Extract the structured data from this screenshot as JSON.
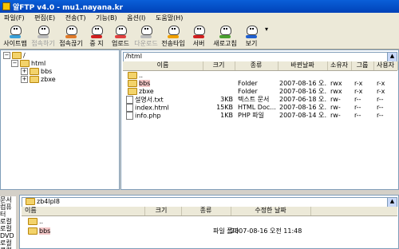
{
  "window": {
    "title": "알FTP v4.0 - mu1.nayana.kr"
  },
  "menu": [
    "파일(F)",
    "편집(E)",
    "전송(T)",
    "기능(B)",
    "옵션(I)",
    "도움말(H)"
  ],
  "toolbar": [
    {
      "label": "사이트맵",
      "enabled": true,
      "color": "#3aa0d8"
    },
    {
      "label": "접속하기",
      "enabled": false,
      "color": "#bbbbbb"
    },
    {
      "label": "접속끊기",
      "enabled": true,
      "color": "#e07a2a"
    },
    {
      "label": "중 지",
      "enabled": true,
      "color": "#d02020"
    },
    {
      "label": "업로드",
      "enabled": true,
      "color": "#e04040"
    },
    {
      "label": "다운로드",
      "enabled": false,
      "color": "#bbbbbb"
    },
    {
      "label": "전송타입",
      "enabled": true,
      "color": "#f0a000"
    },
    {
      "label": "서버",
      "enabled": true,
      "color": "#d02020"
    },
    {
      "label": "새로고침",
      "enabled": true,
      "color": "#4aa030"
    },
    {
      "label": "보기",
      "enabled": true,
      "color": "#2060d0"
    }
  ],
  "tree": {
    "root": "/",
    "items": [
      {
        "label": "html",
        "expander": "−"
      },
      {
        "label": "bbs",
        "expander": "+"
      },
      {
        "label": "zbxe",
        "expander": "+"
      }
    ]
  },
  "remote": {
    "path": "/html",
    "columns": [
      "이름",
      "크기",
      "종류",
      "바뀐날짜",
      "소유자",
      "그룹",
      "사용자"
    ],
    "rows": [
      {
        "name": "..",
        "size": "",
        "type": "",
        "date": "",
        "owner": "",
        "group": "",
        "user": "",
        "selected": false
      },
      {
        "name": "bbs",
        "size": "",
        "type": "Folder",
        "date": "2007-08-16 오...",
        "owner": "rwx",
        "group": "r-x",
        "user": "r-x",
        "selected": true
      },
      {
        "name": "zbxe",
        "size": "",
        "type": "Folder",
        "date": "2007-08-16 오...",
        "owner": "rwx",
        "group": "r-x",
        "user": "r-x",
        "selected": false
      },
      {
        "name": "설명서.txt",
        "size": "3KB",
        "type": "텍스트 문서",
        "date": "2007-06-18 오...",
        "owner": "rw-",
        "group": "r--",
        "user": "r--",
        "selected": false
      },
      {
        "name": "index.html",
        "size": "15KB",
        "type": "HTML Doc...",
        "date": "2007-08-16 오...",
        "owner": "rw-",
        "group": "r--",
        "user": "r--",
        "selected": false
      },
      {
        "name": "info.php",
        "size": "1KB",
        "type": "PHP 파일",
        "date": "2007-08-14 오...",
        "owner": "rw-",
        "group": "r--",
        "user": "r--",
        "selected": false
      }
    ]
  },
  "local": {
    "path": "zb4lpl8",
    "left_labels": [
      "문서",
      "컴퓨터",
      "로컬",
      "로컬",
      "DVD",
      "로컬",
      "로컬"
    ],
    "columns": [
      "이름",
      "크기",
      "종류",
      "수정한 날짜"
    ],
    "rows": [
      {
        "name": "..",
        "size": "",
        "type": "",
        "date": "",
        "selected": false
      },
      {
        "name": "bbs",
        "size": "",
        "type": "파일 폴더",
        "date": "2007-08-16 오전 11:48",
        "selected": true
      }
    ]
  }
}
